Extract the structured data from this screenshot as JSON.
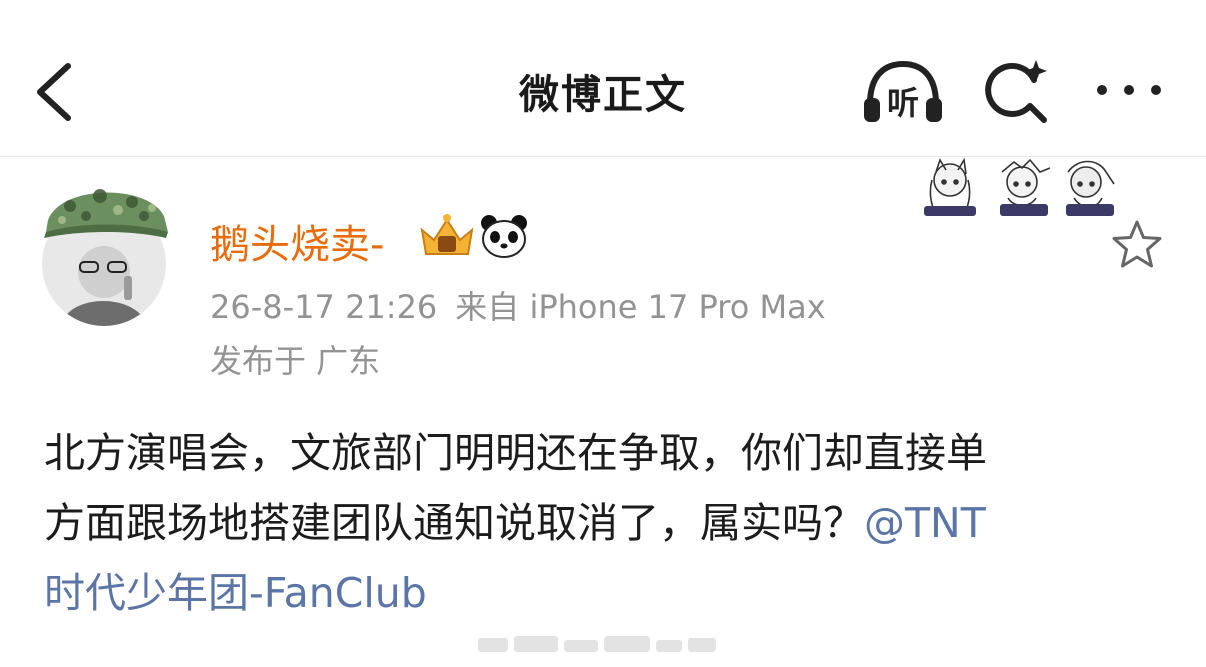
{
  "header": {
    "title": "微博正文",
    "listen_label": "听",
    "icons": [
      "back-icon",
      "listen-icon",
      "search-icon",
      "more-icon"
    ]
  },
  "post": {
    "author": "鹅头烧卖-",
    "timestamp": "26-8-17 21:26",
    "source": "来自 iPhone 17 Pro Max",
    "location": "发布于 广东",
    "content_lines": [
      "北方演唱会，文旅部门明明还在争取，你们却直接单",
      "方面跟场地搭建团队通知说取消了，属实吗？"
    ],
    "mention_part1": "@TNT",
    "mention_part2": "时代少年团-FanClub",
    "badges": [
      "crown-badge-icon",
      "panda-badge-icon"
    ],
    "colors": {
      "username": "#e86b0c",
      "mention": "#5b75a6",
      "meta": "#939393"
    }
  }
}
